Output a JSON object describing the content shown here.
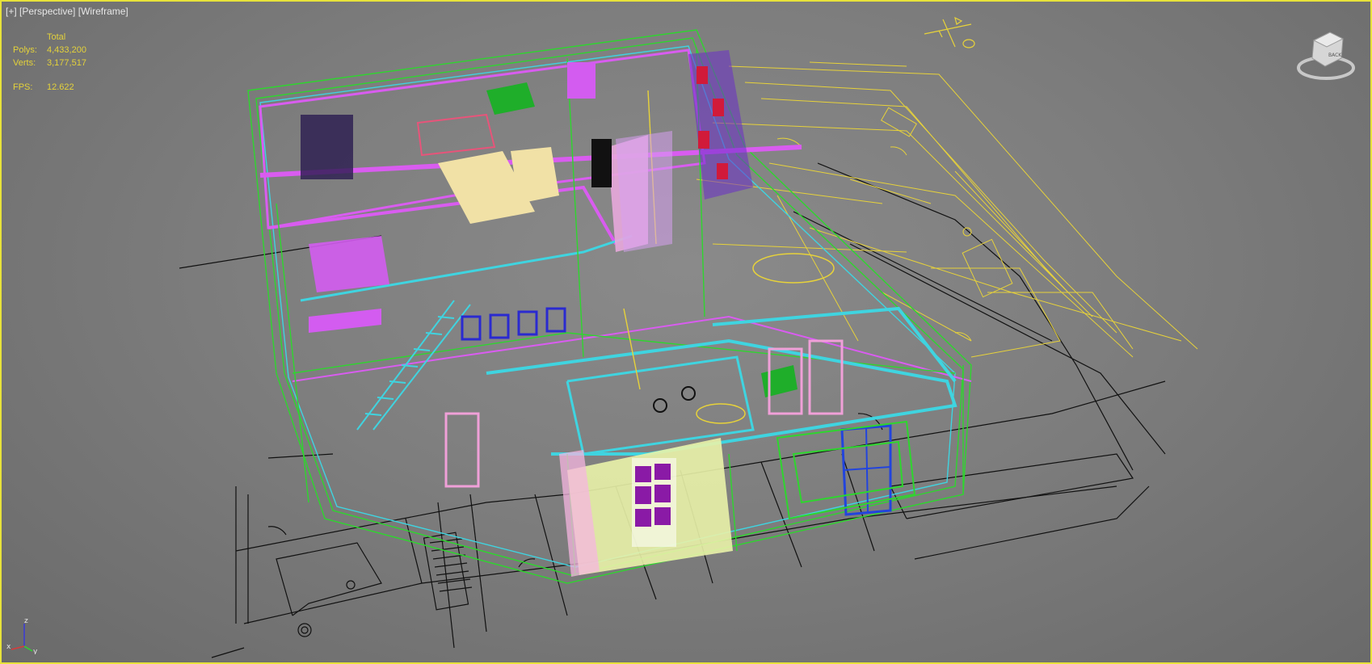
{
  "viewport": {
    "menu": "[+]",
    "view": "[Perspective]",
    "shading": "[Wireframe]"
  },
  "stats": {
    "header": "Total",
    "polys_label": "Polys:",
    "polys_value": "4,433,200",
    "verts_label": "Verts:",
    "verts_value": "3,177,517",
    "fps_label": "FPS:",
    "fps_value": "12.622"
  },
  "axis": {
    "z": "z",
    "x": "x",
    "y": "y"
  },
  "viewcube": {
    "face": "BACK",
    "icon": "viewcube-icon"
  },
  "colors": {
    "border": "#e7e23a",
    "stats_text": "#e4d23a",
    "wire_yellow": "#e7d23a",
    "wire_green": "#2ed62e",
    "wire_cyan": "#3fd4e0",
    "wire_magenta": "#d95cf0",
    "wire_purple": "#5522cc",
    "wire_pink": "#f0a0d8",
    "wire_cream": "#f0e0a0",
    "wire_black": "#111111"
  }
}
